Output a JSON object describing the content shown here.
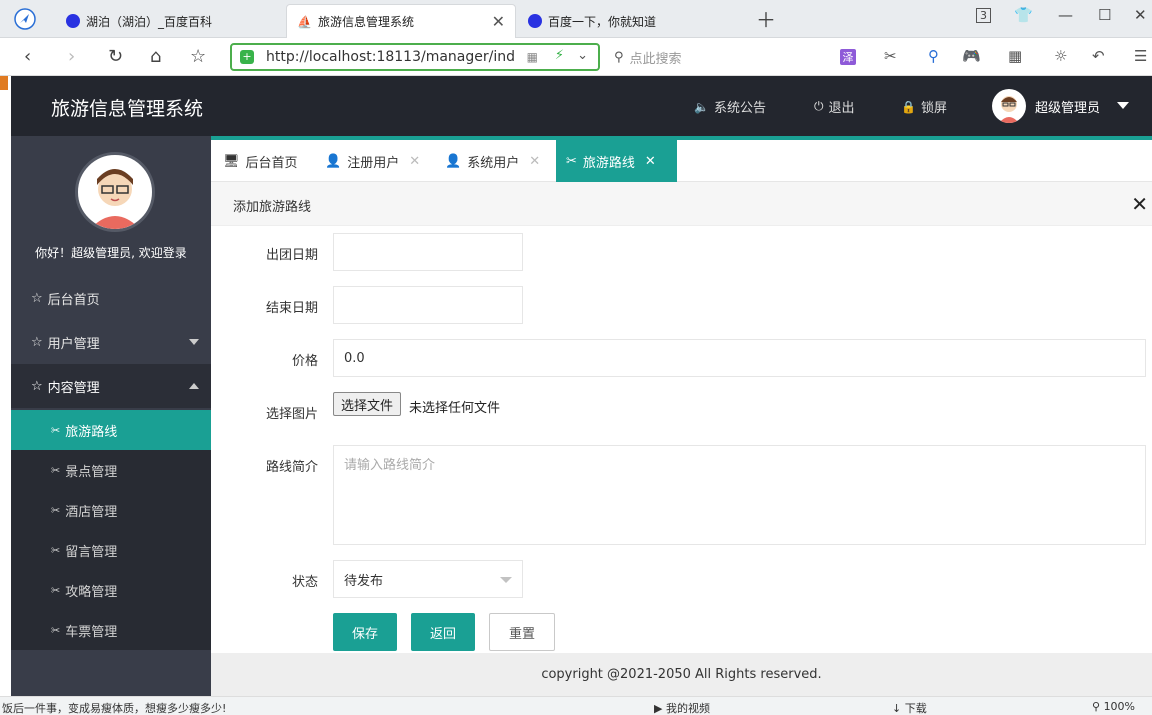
{
  "browser": {
    "tabs": [
      {
        "label": "湖泊（湖泊）_百度百科",
        "favicon_color": "#2932e1"
      },
      {
        "label": "旅游信息管理系统",
        "favicon_color": "#222222"
      },
      {
        "label": "百度一下，你就知道",
        "favicon_color": "#2932e1"
      }
    ],
    "tab_count": "3",
    "url": "http://localhost:18113/manager/ind",
    "search_placeholder": "点此搜索"
  },
  "header": {
    "title": "旅游信息管理系统",
    "notice_label": "系统公告",
    "logout_label": "退出",
    "lock_label": "锁屏",
    "user_name": "超级管理员"
  },
  "sidebar": {
    "welcome": "你好！超级管理员, 欢迎登录",
    "items": [
      {
        "label": "后台首页"
      },
      {
        "label": "用户管理"
      },
      {
        "label": "内容管理"
      }
    ],
    "sub_items": [
      {
        "label": "旅游路线"
      },
      {
        "label": "景点管理"
      },
      {
        "label": "酒店管理"
      },
      {
        "label": "留言管理"
      },
      {
        "label": "攻略管理"
      },
      {
        "label": "车票管理"
      }
    ]
  },
  "content_tabs": [
    {
      "label": "后台首页"
    },
    {
      "label": "注册用户"
    },
    {
      "label": "系统用户"
    },
    {
      "label": "旅游路线"
    }
  ],
  "panel": {
    "title": "添加旅游路线"
  },
  "form": {
    "start_date_label": "出团日期",
    "end_date_label": "结束日期",
    "price_label": "价格",
    "price_value": "0.0",
    "image_label": "选择图片",
    "file_button": "选择文件",
    "file_status": "未选择任何文件",
    "intro_label": "路线简介",
    "intro_placeholder": "请输入路线简介",
    "status_label": "状态",
    "status_value": "待发布",
    "save_label": "保存",
    "back_label": "返回",
    "reset_label": "重置"
  },
  "footer": {
    "copyright": "copyright @2021-2050 All Rights reserved."
  },
  "statusbar": {
    "news": "饭后一件事，变成易瘦体质，想瘦多少瘦多少!",
    "video": "我的视频",
    "download": "下载",
    "zoom": "100%"
  },
  "colors": {
    "accent": "#1aa094",
    "sidebar": "#393d49",
    "header": "#23262e"
  }
}
